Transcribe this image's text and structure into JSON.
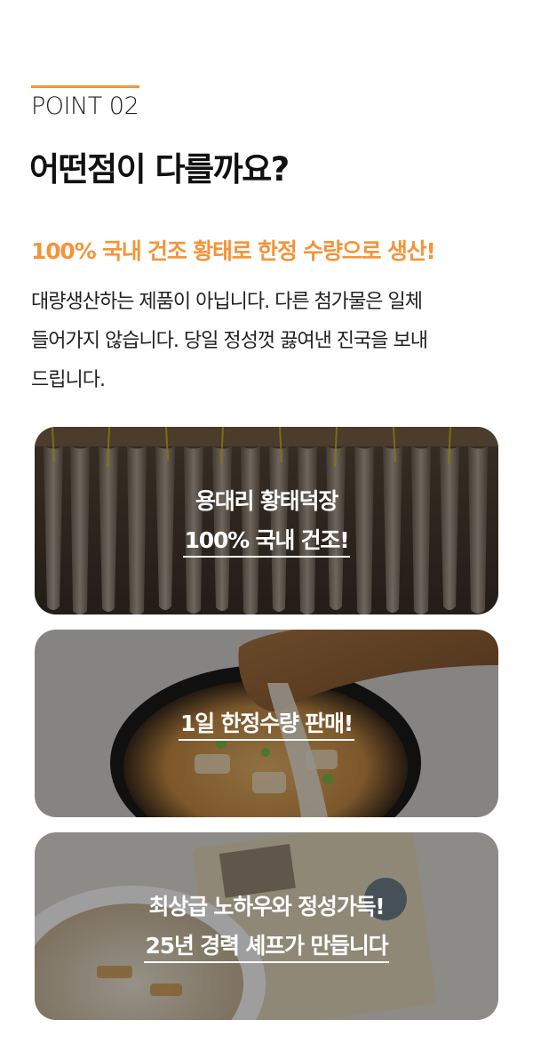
{
  "header": {
    "point_label": "POINT 02",
    "title": "어떤점이 다를까요?"
  },
  "highlight": "100% 국내 건조 황태로 한정 수량으로 생산!",
  "description_lines": [
    "대량생산하는 제품이 아닙니다. 다른 첨가물은 일체",
    "들어가지 않습니다. 당일 정성껏 끓여낸 진국을 보내",
    "드립니다."
  ],
  "cards": [
    {
      "image": "dried-pollack-hanging-photo",
      "line1": "용대리 황태덕장",
      "line2": "100% 국내 건조!"
    },
    {
      "image": "soup-ladle-pouring-photo",
      "line1": "1일 한정수량 판매!"
    },
    {
      "image": "soup-bowl-and-package-photo",
      "line1": "최상급 노하우와 정성가득!",
      "line2": "25년 경력 셰프가 만듭니다"
    }
  ],
  "colors": {
    "accent": "#f4943a",
    "text": "#1a1a1a"
  }
}
